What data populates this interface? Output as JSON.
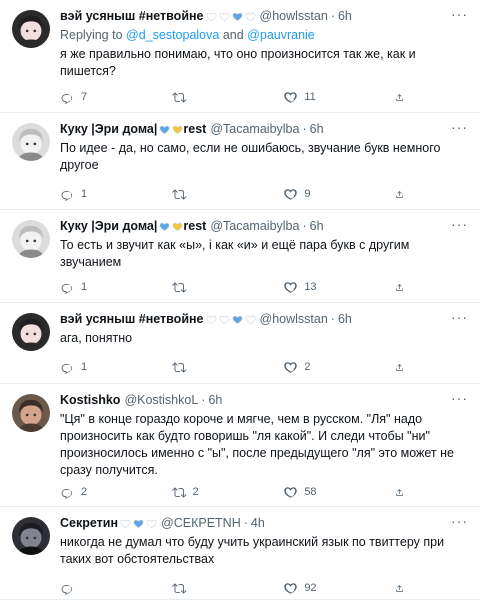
{
  "tweets": [
    {
      "name": "вэй усяныш #нетвойне",
      "hearts": [
        "#ffffff",
        "#ffffff",
        "#60a5e8",
        "#ffffff"
      ],
      "handle": "@howlsstan",
      "time": "6h",
      "reply_prefix": "Replying to",
      "reply_users": [
        "@d_sestopalova",
        "@pauvranie"
      ],
      "reply_and": "and",
      "text": "я же правильно понимаю, что оно произносится так же, как и пишется?",
      "replies": "7",
      "retweets": "",
      "likes": "11"
    },
    {
      "name": "Куку |Эри дома|",
      "hearts": [
        "#60a5e8",
        "#f4c542"
      ],
      "name_suffix": "rest",
      "handle": "@Tacamaibylba",
      "time": "6h",
      "text": "По идее - да, но само, если не ошибаюсь, звучание букв немного другое",
      "replies": "1",
      "retweets": "",
      "likes": "9"
    },
    {
      "name": "Куку |Эри дома|",
      "hearts": [
        "#60a5e8",
        "#f4c542"
      ],
      "name_suffix": "rest",
      "handle": "@Tacamaibylba",
      "time": "6h",
      "text": "То есть и звучит как «ы», і как «и» и ещё пара букв с другим звучанием",
      "replies": "1",
      "retweets": "",
      "likes": "13"
    },
    {
      "name": "вэй усяныш #нетвойне",
      "hearts": [
        "#ffffff",
        "#ffffff",
        "#60a5e8",
        "#ffffff"
      ],
      "handle": "@howlsstan",
      "time": "6h",
      "text": "ага, понятно",
      "replies": "1",
      "retweets": "",
      "likes": "2"
    },
    {
      "name": "Kostishko",
      "hearts": [],
      "handle": "@KostishkoL",
      "time": "6h",
      "text": "\"Ця\" в конце гораздо короче и мягче, чем в русском. \"Ля\" надо произносить как будто говоришь \"ля какой\". И следи чтобы \"ни\" произносилось именно с \"ы\", после предыдущего \"ля\" это может не сразу получится.",
      "replies": "2",
      "retweets": "2",
      "likes": "58"
    },
    {
      "name": "Секретин",
      "hearts": [
        "#ffffff",
        "#60a5e8",
        "#ffffff"
      ],
      "handle": "@СЕКРЕТNH",
      "time": "4h",
      "text": "никогда не думал что буду учить украинский язык по твиттеру при таких вот обстоятельствах",
      "replies": "",
      "retweets": "",
      "likes": "92"
    }
  ],
  "ui": {
    "more_glyph": "···",
    "separator": "·"
  },
  "colors": {
    "link": "#1d9bf0",
    "secondary_text": "#536471",
    "heart_blue": "#60a5e8",
    "heart_yellow": "#f4c542"
  }
}
